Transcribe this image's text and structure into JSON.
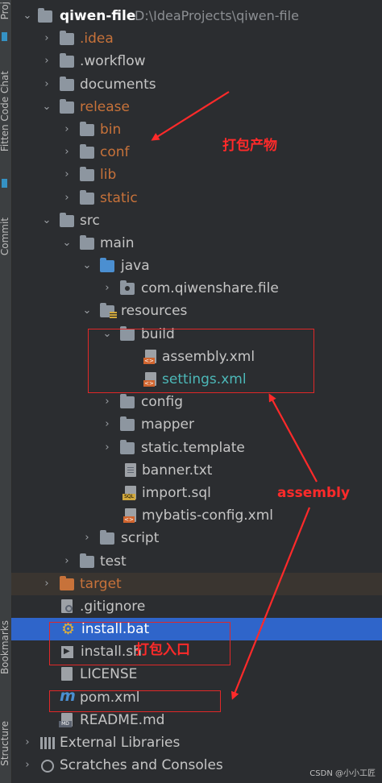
{
  "side_panel": {
    "labels": [
      "Proj",
      "Fitten Code Chat",
      "Commit",
      "Bookmarks",
      "Structure"
    ]
  },
  "tree": {
    "root": {
      "name": "qiwen-file",
      "path": "D:\\IdeaProjects\\qiwen-file"
    },
    "items": [
      {
        "label": ".idea"
      },
      {
        "label": ".workflow"
      },
      {
        "label": "documents"
      },
      {
        "label": "release"
      },
      {
        "label": "bin"
      },
      {
        "label": "conf"
      },
      {
        "label": "lib"
      },
      {
        "label": "static"
      },
      {
        "label": "src"
      },
      {
        "label": "main"
      },
      {
        "label": "java"
      },
      {
        "label": "com.qiwenshare.file"
      },
      {
        "label": "resources"
      },
      {
        "label": "build"
      },
      {
        "label": "assembly.xml"
      },
      {
        "label": "settings.xml"
      },
      {
        "label": "config"
      },
      {
        "label": "mapper"
      },
      {
        "label": "static.template"
      },
      {
        "label": "banner.txt"
      },
      {
        "label": "import.sql"
      },
      {
        "label": "mybatis-config.xml"
      },
      {
        "label": "script"
      },
      {
        "label": "test"
      },
      {
        "label": "target"
      },
      {
        "label": ".gitignore"
      },
      {
        "label": "install.bat"
      },
      {
        "label": "install.sh"
      },
      {
        "label": "LICENSE"
      },
      {
        "label": "pom.xml"
      },
      {
        "label": "README.md"
      },
      {
        "label": "External Libraries"
      },
      {
        "label": "Scratches and Consoles"
      }
    ]
  },
  "annotations": {
    "output": "打包产物",
    "assembly": "assembly",
    "entry": "打包入口"
  },
  "colors": {
    "annotation": "#ff2a2a",
    "selection": "#2f65ca",
    "excluded_folder": "#c7723a"
  },
  "watermark": "CSDN @小小工匠"
}
